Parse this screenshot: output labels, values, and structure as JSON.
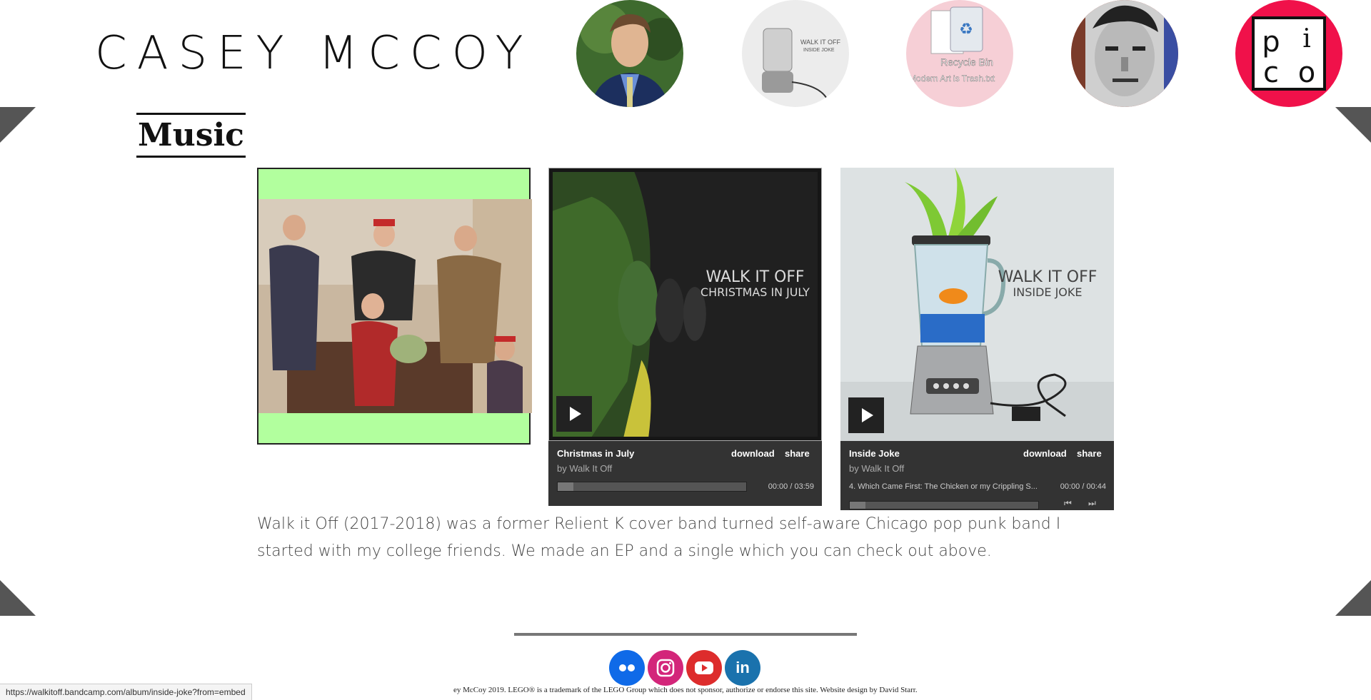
{
  "site": {
    "title": "CASEY MCCOY"
  },
  "nav": {
    "items": [
      {
        "name": "portrait",
        "color": "#2d5a27"
      },
      {
        "name": "walk-it-off-inside-joke",
        "label": "WALK IT OFF",
        "sublabel": "INSIDE JOKE"
      },
      {
        "name": "recycle-bin",
        "label": "Recycle Bin",
        "sublabel": "Modern Art is Trash.txt"
      },
      {
        "name": "pixel-portrait"
      },
      {
        "name": "pico",
        "letters": [
          "p",
          "i",
          "c",
          "o"
        ],
        "color": "#f0114a"
      }
    ]
  },
  "page": {
    "heading": "Music"
  },
  "albums": [
    {
      "name": "band-photo",
      "border_color": "#b2ff9e"
    },
    {
      "name": "christmas-in-july",
      "art_title": "WALK IT OFF",
      "art_subtitle": "CHRISTMAS IN JULY",
      "title": "Christmas in July",
      "artist": "by Walk It Off",
      "download": "download",
      "share": "share",
      "time": "00:00 / 03:59"
    },
    {
      "name": "inside-joke",
      "art_title": "WALK IT OFF",
      "art_subtitle": "INSIDE JOKE",
      "title": "Inside Joke",
      "artist": "by Walk It Off",
      "download": "download",
      "share": "share",
      "track": "4.  Which Came First: The Chicken or my Crippling S...",
      "time": "00:00 / 00:44"
    }
  ],
  "description": "Walk it Off (2017-2018) was a former Relient K cover band turned self-aware Chicago pop punk band I started with my college friends. We made an EP and a single which you can check out above.",
  "social": [
    {
      "name": "flickr",
      "color": "#0f6ae8"
    },
    {
      "name": "instagram",
      "color": "#d3267a"
    },
    {
      "name": "youtube",
      "color": "#dd2c2c"
    },
    {
      "name": "linkedin",
      "color": "#1a72ad",
      "label": "in"
    }
  ],
  "footer": {
    "copyright": "ey McCoy 2019. LEGO® is a trademark of the LEGO Group which does not sponsor, authorize or endorse this site. Website design by David Starr."
  },
  "status_bar": {
    "url": "https://walkitoff.bandcamp.com/album/inside-joke?from=embed"
  }
}
